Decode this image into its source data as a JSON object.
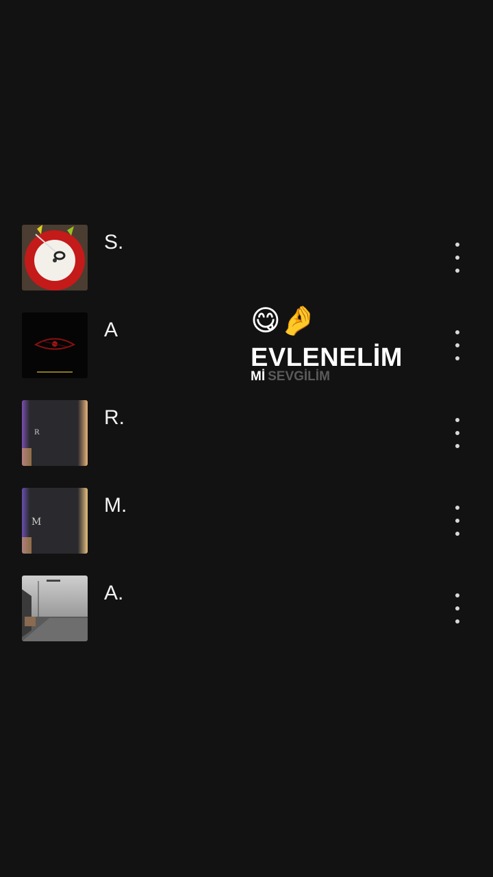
{
  "tracks": [
    {
      "title": "S.",
      "art": "red-vinyl-cover"
    },
    {
      "title": "A",
      "art": "dark-eye-cover"
    },
    {
      "title": "R.",
      "art": "light-leak-cover-r"
    },
    {
      "title": "M.",
      "art": "light-leak-cover-m"
    },
    {
      "title": "A.",
      "art": "street-photo-cover"
    }
  ],
  "overlay": {
    "emoji": "😋🤌",
    "headline": "EVLENELİM",
    "sub_word1": "Mİ",
    "sub_word2": "SEVGİLİM"
  },
  "colors": {
    "background": "#121212",
    "text": "#ffffff",
    "muted": "#5a5a5a"
  }
}
